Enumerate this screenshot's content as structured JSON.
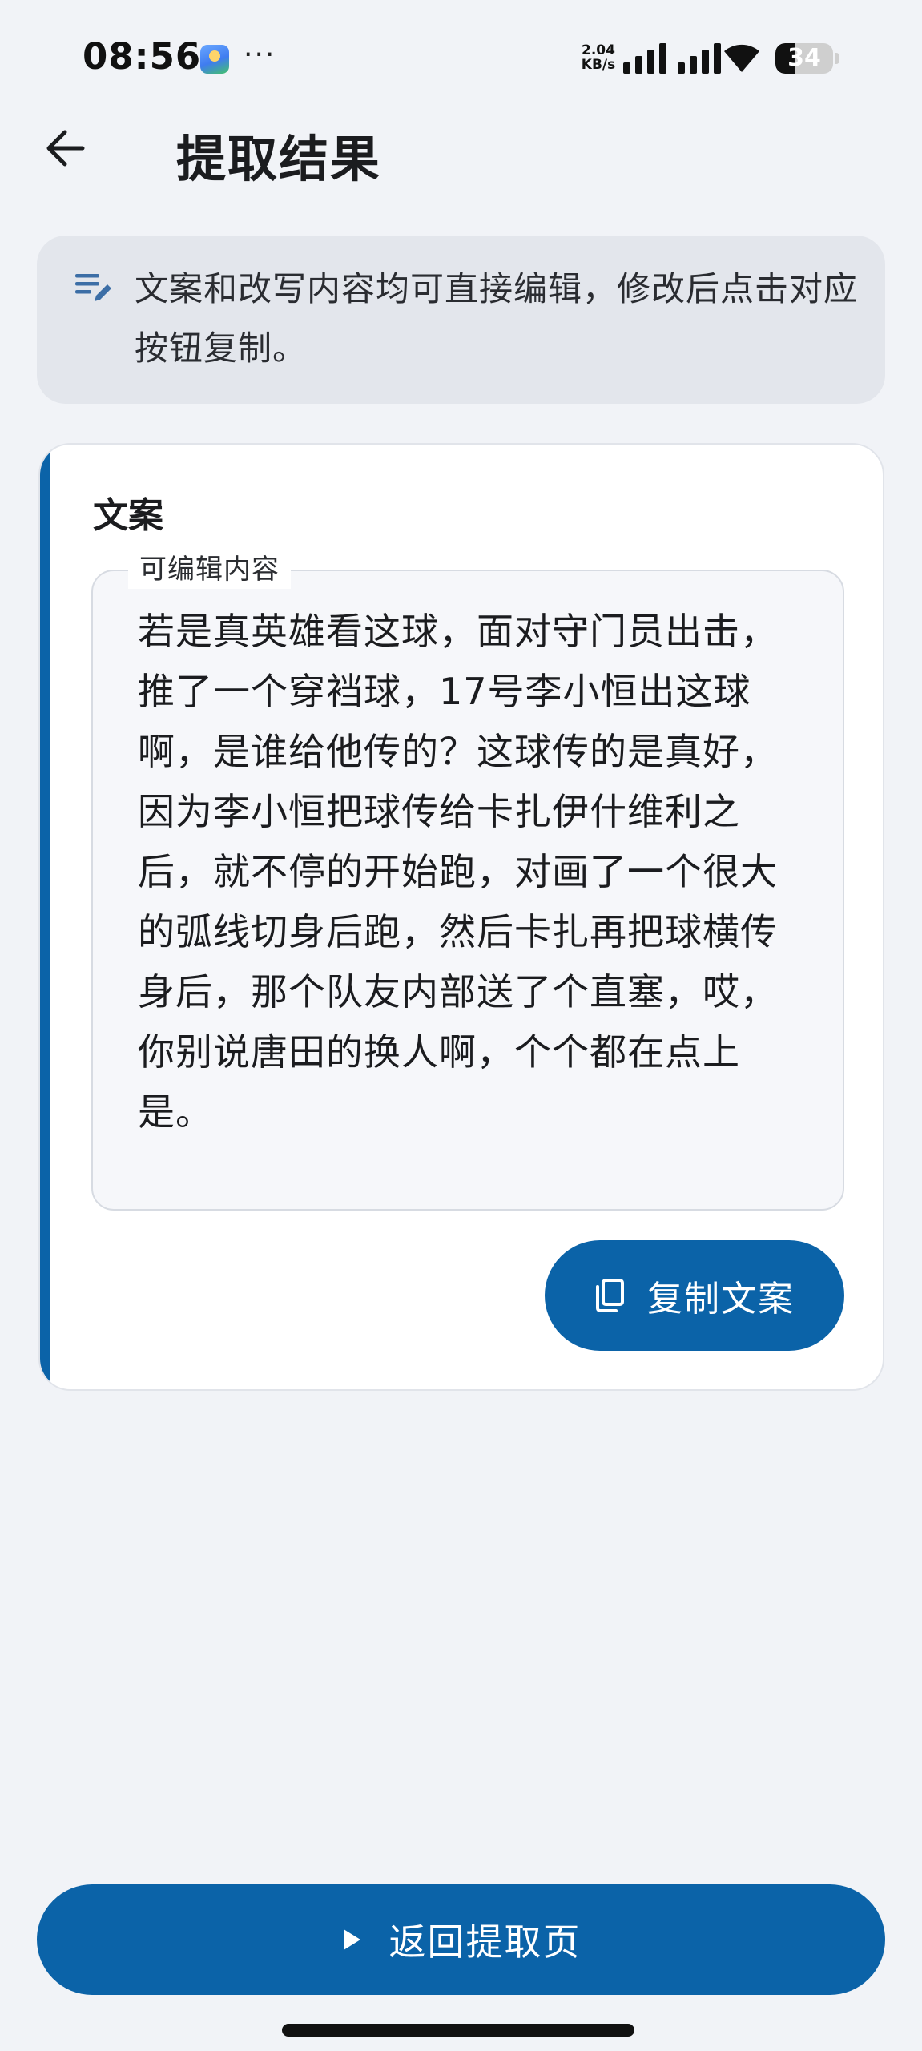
{
  "status_bar": {
    "time": "08:56",
    "net_speed_value": "2.04",
    "net_speed_unit": "KB/s",
    "battery": "34"
  },
  "header": {
    "title": "提取结果"
  },
  "info_banner": {
    "text": "文案和改写内容均可直接编辑，修改后点击对应按钮复制。"
  },
  "card": {
    "title": "文案",
    "field_label": "可编辑内容",
    "content": "若是真英雄看这球，面对守门员出击，推了一个穿裆球，17号李小恒出这球啊，是谁给他传的？这球传的是真好，因为李小恒把球传给卡扎伊什维利之后，就不停的开始跑，对画了一个很大的弧线切身后跑，然后卡扎再把球横传身后，那个队友内部送了个直塞，哎，你别说唐田的换人啊，个个都在点上是。",
    "copy_label": "复制文案"
  },
  "footer": {
    "return_label": "返回提取页"
  },
  "colors": {
    "primary": "#0b63a8",
    "background": "#f1f3f7",
    "banner": "#e3e6ec"
  },
  "icons": {
    "back": "arrow-left-icon",
    "info": "edit-note-icon",
    "copy": "copy-icon",
    "play": "play-icon"
  }
}
